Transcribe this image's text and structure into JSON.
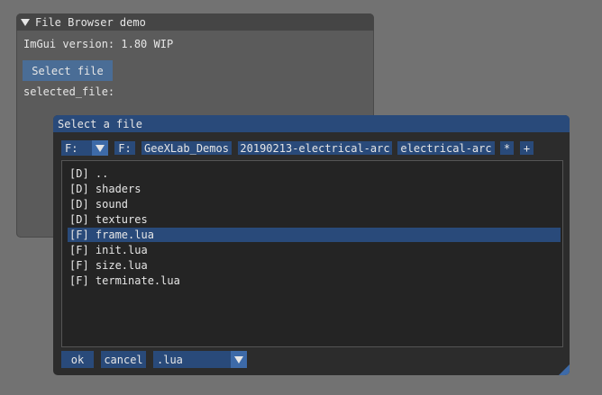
{
  "main_window": {
    "title": "File Browser demo",
    "version_text": "ImGui version: 1.80 WIP",
    "select_button_label": "Select file",
    "selected_file_label": "selected_file:"
  },
  "dialog": {
    "title": "Select a file",
    "drive_combo_value": "F:",
    "path_segments": [
      "F:",
      "GeeXLab_Demos",
      "20190213-electrical-arc",
      "electrical-arc"
    ],
    "new_dir_label": "*",
    "add_label": "+",
    "files": [
      {
        "label": "[D] ..",
        "selected": false
      },
      {
        "label": "[D] shaders",
        "selected": false
      },
      {
        "label": "[D] sound",
        "selected": false
      },
      {
        "label": "[D] textures",
        "selected": false
      },
      {
        "label": "[F] frame.lua",
        "selected": true
      },
      {
        "label": "[F] init.lua",
        "selected": false
      },
      {
        "label": "[F] size.lua",
        "selected": false
      },
      {
        "label": "[F] terminate.lua",
        "selected": false
      }
    ],
    "ok_label": "ok",
    "cancel_label": "cancel",
    "filter_value": ".lua"
  },
  "colors": {
    "background": "#727272",
    "accent": "#294a7a",
    "accent_bright": "#3d6aa8",
    "button": "#4a6d96"
  }
}
